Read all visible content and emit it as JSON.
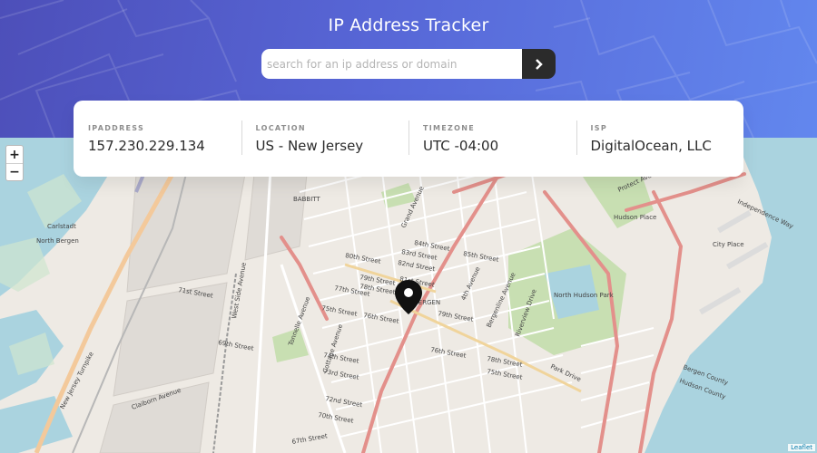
{
  "header": {
    "title": "IP Address Tracker",
    "search_placeholder": "search for an ip address or domain",
    "search_value": ""
  },
  "info": {
    "ip_label": "IPADDRESS",
    "ip_value": "157.230.229.134",
    "location_label": "LOCATION",
    "location_value": "US - New Jersey",
    "timezone_label": "TIMEZONE",
    "timezone_value": "UTC -04:00",
    "isp_label": "ISP",
    "isp_value": "DigitalOcean, LLC"
  },
  "map": {
    "zoom_in": "+",
    "zoom_out": "−",
    "attribution": "Leaflet",
    "labels": {
      "babbitt": "BABBITT",
      "bergen": "BERGEN",
      "north_bergen": "North Bergen",
      "carlstadt": "Carlstadt",
      "north_hudson_park": "North Hudson Park",
      "hudson_county": "Hudson County",
      "bergen_county": "Bergen County",
      "city_place": "City Place",
      "independence_way": "Independence Way",
      "hudson_place": "Hudson Place",
      "protect_avenue": "Protect Avenue",
      "grand_avenue": "Grand Avenue",
      "fourth_avenue": "4th Avenue",
      "bergenline_avenue": "Bergenline Avenue",
      "riverview_drive": "Riverview Drive",
      "park_drive": "Park Drive",
      "westside_avenue": "West Side Avenue",
      "tonnelle_avenue": "Tonnelle Avenue",
      "cottage_avenue": "Cottage Avenue",
      "clairborn_avenue": "Claiborn Avenue",
      "turnpike": "New Jersey Turnpike",
      "s84": "84th Street",
      "s83": "83rd Street",
      "s82": "82nd Street",
      "s81": "81st Street",
      "s85": "85th Street",
      "s80": "80th Street",
      "s79": "79th Street",
      "s78": "78th Street",
      "s77": "77th Street",
      "s76": "76th Street",
      "s75": "75th Street",
      "s74": "74th Street",
      "s73": "73rd Street",
      "s72": "72nd Street",
      "s71": "71st Street",
      "s70": "70th Street",
      "s69": "69th Street",
      "s67": "67th Street",
      "s79b": "79th Street",
      "s78b": "78th Street",
      "s76b": "76th Street",
      "s75b": "75th Street"
    }
  },
  "colors": {
    "accent_dark": "#2b2b2b",
    "water": "#aad3df",
    "road_major": "#e3908b",
    "park": "#c8dfb2"
  }
}
